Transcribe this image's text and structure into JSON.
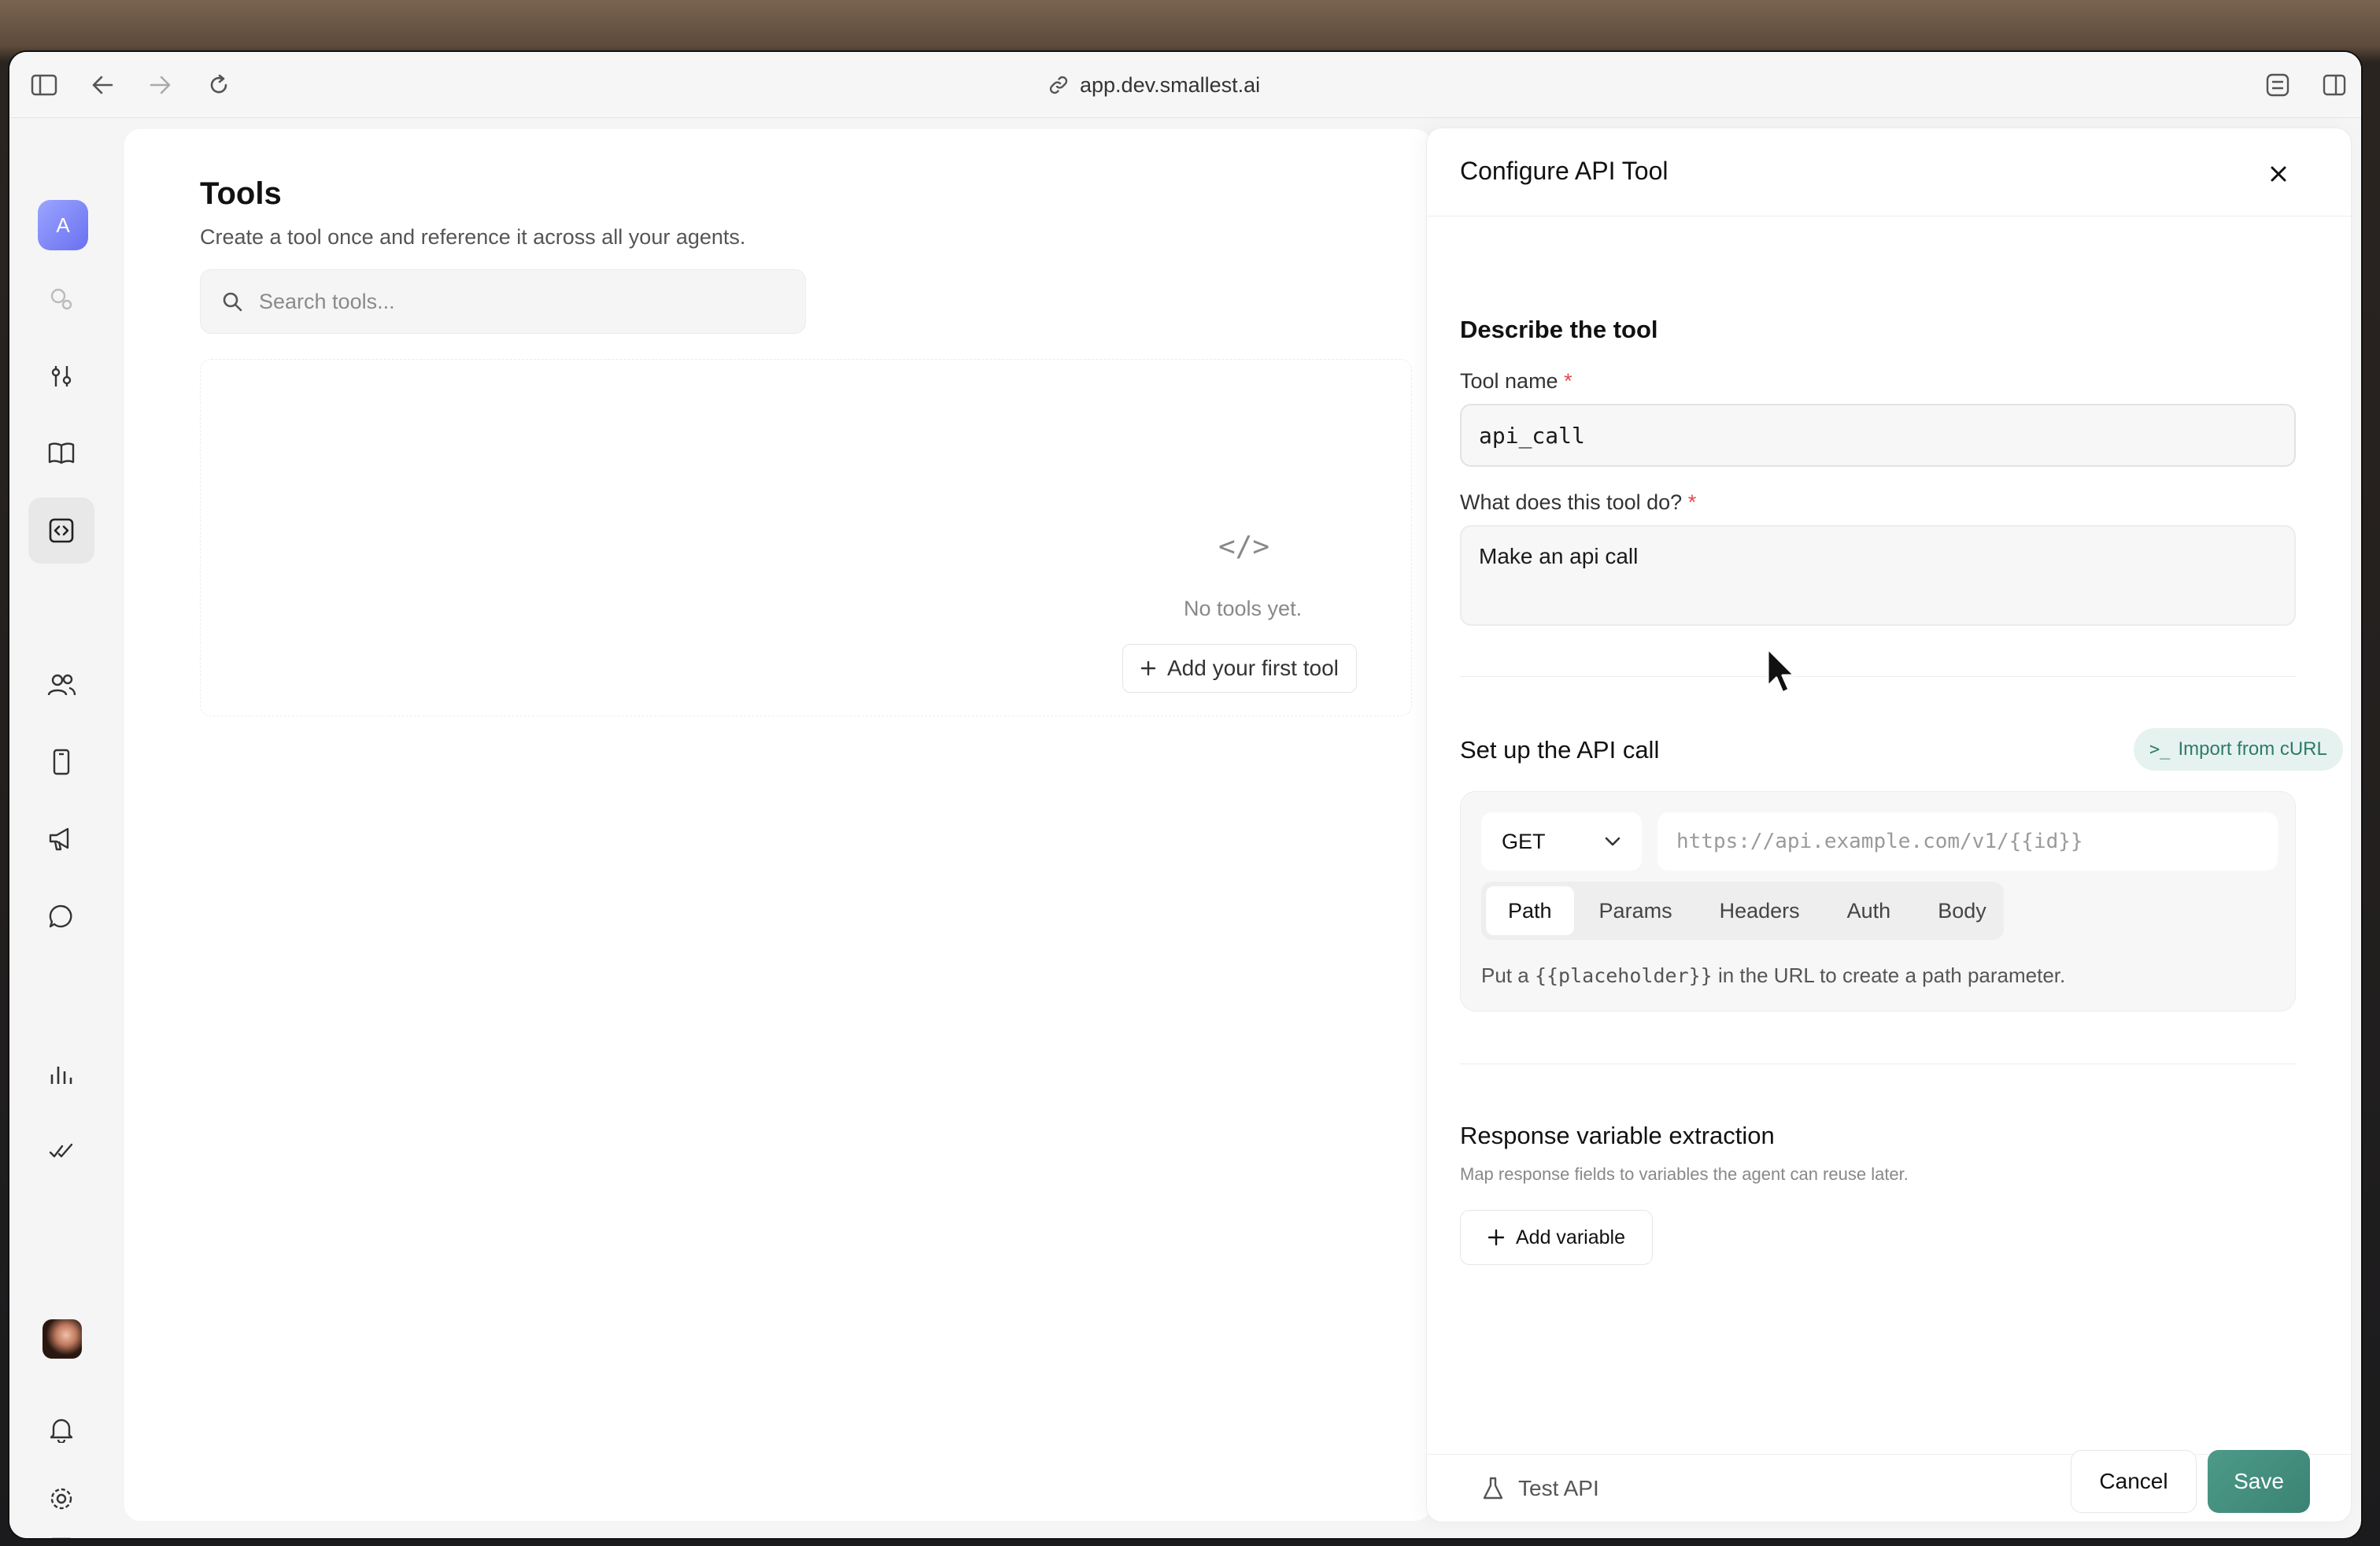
{
  "browser": {
    "url": "app.dev.smallest.ai"
  },
  "rail": {
    "workspace_initial": "A"
  },
  "tools_page": {
    "title": "Tools",
    "subtitle": "Create a tool once and reference it across all your agents.",
    "search_placeholder": "Search tools...",
    "empty_icon": "</>",
    "empty_text": "No tools yet.",
    "add_first_label": "Add your first tool"
  },
  "panel": {
    "title": "Configure API Tool",
    "describe": {
      "section_title": "Describe the tool",
      "name_label": "Tool name",
      "name_value": "api_call",
      "desc_label": "What does this tool do?",
      "desc_value": "Make an api call",
      "required_mark": "*"
    },
    "api": {
      "section_title": "Set up the API call",
      "import_label": "Import from cURL",
      "method": "GET",
      "url_placeholder": "https://api.example.com/v1/{{id}}",
      "tabs": [
        {
          "label": "Path"
        },
        {
          "label": "Params"
        },
        {
          "label": "Headers"
        },
        {
          "label": "Auth"
        },
        {
          "label": "Body"
        }
      ],
      "hint_prefix": "Put a",
      "hint_code": "{{placeholder}}",
      "hint_suffix": "in the URL to create a path parameter."
    },
    "response": {
      "section_title": "Response variable extraction",
      "subtitle": "Map response fields to variables the agent can reuse later.",
      "add_label": "Add variable"
    },
    "footer": {
      "test_label": "Test API",
      "cancel_label": "Cancel",
      "save_label": "Save"
    }
  },
  "colors": {
    "accent": "#3b8373",
    "import_bg": "#e6f2ef",
    "required": "#e5484d"
  }
}
